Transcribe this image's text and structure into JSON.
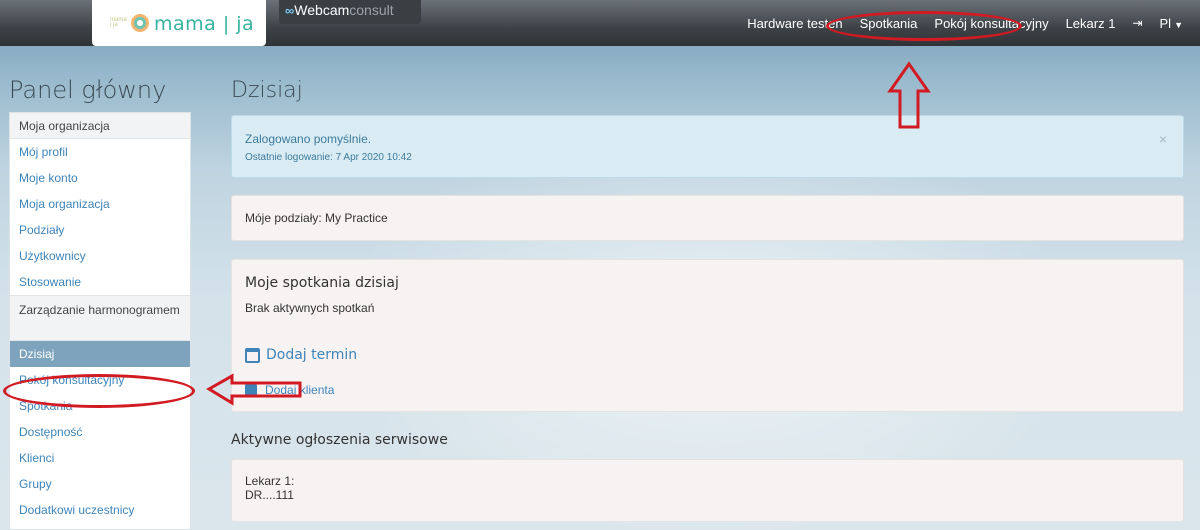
{
  "header": {
    "logo_small": "mama i ja",
    "logo_text": "mama | ja",
    "webcam_brand_bold": "Webcam",
    "webcam_brand_light": "consult",
    "nav": {
      "hardware": "Hardware testen",
      "meetings": "Spotkania",
      "consult_room": "Pokój konsultacyjny",
      "user": "Lekarz 1",
      "lang": "Pl"
    }
  },
  "sidebar": {
    "title": "Panel główny",
    "section1": "Moja organizacja",
    "items1": [
      "Mój profil",
      "Moje konto",
      "Moja organizacja",
      "Podziały",
      "Użytkownicy",
      "Stosowanie"
    ],
    "section2": "Zarządzanie harmonogramem",
    "items2": [
      "Dzisiaj",
      "Pokój konsultacyjny",
      "Spotkania",
      "Dostępność",
      "Klienci",
      "Grupy",
      "Dodatkowi uczestnicy"
    ]
  },
  "main": {
    "title": "Dzisiaj",
    "alert_line1": "Zalogowano pomyślnie.",
    "alert_line2": "Ostatnie logowanie: 7 Apr 2020 10:42",
    "close_symbol": "×",
    "divisions": "Móje podziały: My Practice",
    "meetings_title": "Moje spotkania dzisiaj",
    "no_meetings": "Brak aktywnych spotkań",
    "add_term": "Dodaj termin",
    "add_client": "Dodaj klienta",
    "service_title": "Aktywne ogłoszenia serwisowe",
    "service_line1": "Lekarz 1:",
    "service_line2": "DR....111"
  },
  "colors": {
    "accent": "#3e84b9",
    "annotation": "#d21a22",
    "active": "#7ea3bd"
  }
}
